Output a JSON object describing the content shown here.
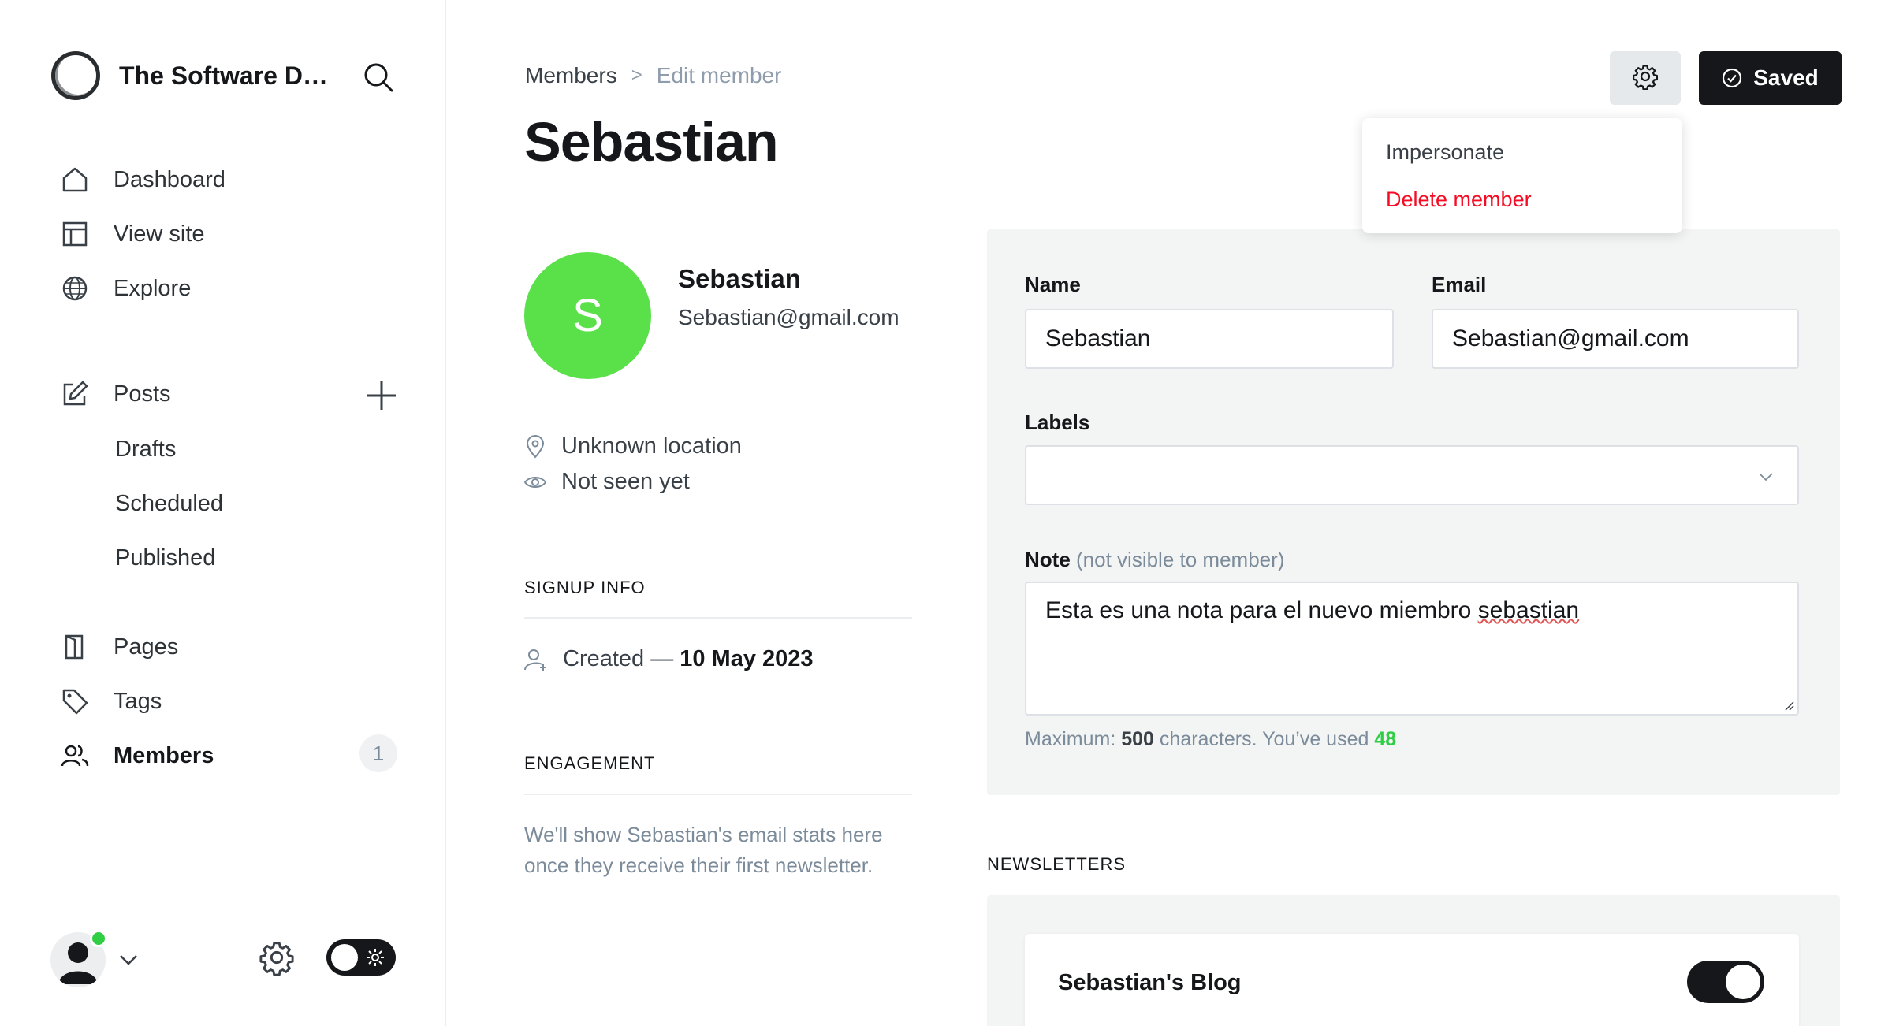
{
  "sidebar": {
    "brand_title": "The Software De...",
    "nav": {
      "dashboard": "Dashboard",
      "view_site": "View site",
      "explore": "Explore",
      "posts": "Posts",
      "drafts": "Drafts",
      "scheduled": "Scheduled",
      "published": "Published",
      "pages": "Pages",
      "tags": "Tags",
      "members": "Members",
      "members_count": "1"
    },
    "status_color": "#30cf43"
  },
  "breadcrumb": {
    "parent": "Members",
    "separator": ">",
    "current": "Edit member"
  },
  "page_title": "Sebastian",
  "toolbar": {
    "saved_label": "Saved"
  },
  "menu": {
    "impersonate": "Impersonate",
    "delete": "Delete member"
  },
  "member": {
    "initial": "S",
    "avatar_color": "#5ae14a",
    "name": "Sebastian",
    "email": "Sebastian@gmail.com",
    "location": "Unknown location",
    "last_seen": "Not seen yet"
  },
  "signup": {
    "heading": "SIGNUP INFO",
    "created_prefix": "Created —",
    "created_date": "10 May 2023"
  },
  "engagement": {
    "heading": "ENGAGEMENT",
    "text": "We'll show Sebastian's email stats here once they receive their first newsletter."
  },
  "form": {
    "name_label": "Name",
    "name_value": "Sebastian",
    "email_label": "Email",
    "email_value": "Sebastian@gmail.com",
    "labels_label": "Labels",
    "note_label": "Note",
    "note_hint": "(not visible to member)",
    "note_text_before": "Esta es una nota para el nuevo miembro ",
    "note_text_misspelled": "sebastian",
    "count_prefix": "Maximum:",
    "count_max": "500",
    "count_middle": "characters. You’ve used",
    "count_used": "48"
  },
  "newsletters": {
    "heading": "NEWSLETTERS",
    "items": [
      {
        "name": "Sebastian's Blog",
        "subscribed": true
      }
    ]
  }
}
